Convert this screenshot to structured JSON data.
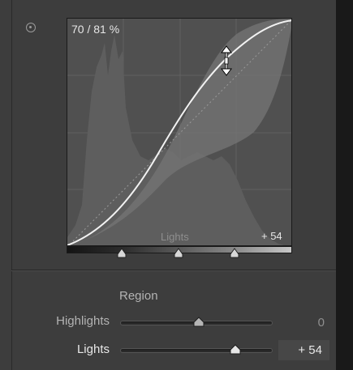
{
  "tone_curve": {
    "readout": "70 / 81 %",
    "hover_region_label": "Lights",
    "hover_region_value": "+ 54",
    "split_points": [
      0.25,
      0.5,
      0.75
    ]
  },
  "region_section": {
    "title": "Region",
    "sliders": [
      {
        "label": "Highlights",
        "value": "0",
        "position": 0.5,
        "active": false
      },
      {
        "label": "Lights",
        "value": "+ 54",
        "position": 0.77,
        "active": true
      }
    ]
  },
  "colors": {
    "panel_bg": "#3d3d3d",
    "graph_bg": "#505050",
    "curve": "#f2f2f2",
    "active_text": "#e8e8e8"
  },
  "icons": {
    "target_adjust": "target-adjust-icon",
    "cursor": "vertical-resize-cursor-icon",
    "thumb": "triangle-thumb-icon"
  }
}
